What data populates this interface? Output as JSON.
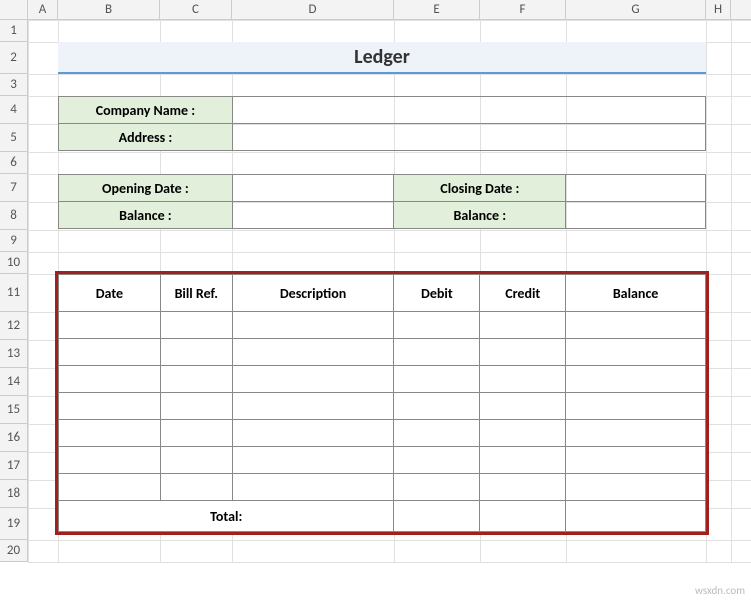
{
  "columns": [
    {
      "label": "A",
      "width": 30
    },
    {
      "label": "B",
      "width": 102
    },
    {
      "label": "C",
      "width": 72
    },
    {
      "label": "D",
      "width": 162
    },
    {
      "label": "E",
      "width": 86
    },
    {
      "label": "F",
      "width": 86
    },
    {
      "label": "G",
      "width": 140
    },
    {
      "label": "H",
      "width": 25
    }
  ],
  "rows": [
    {
      "label": "1",
      "height": 22
    },
    {
      "label": "2",
      "height": 32
    },
    {
      "label": "3",
      "height": 22
    },
    {
      "label": "4",
      "height": 28
    },
    {
      "label": "5",
      "height": 28
    },
    {
      "label": "6",
      "height": 22
    },
    {
      "label": "7",
      "height": 28
    },
    {
      "label": "8",
      "height": 28
    },
    {
      "label": "9",
      "height": 22
    },
    {
      "label": "10",
      "height": 22
    },
    {
      "label": "11",
      "height": 38
    },
    {
      "label": "12",
      "height": 28
    },
    {
      "label": "13",
      "height": 28
    },
    {
      "label": "14",
      "height": 28
    },
    {
      "label": "15",
      "height": 28
    },
    {
      "label": "16",
      "height": 28
    },
    {
      "label": "17",
      "height": 28
    },
    {
      "label": "18",
      "height": 28
    },
    {
      "label": "19",
      "height": 32
    },
    {
      "label": "20",
      "height": 22
    }
  ],
  "title": "Ledger",
  "info": {
    "company_label": "Company Name :",
    "company_value": "",
    "address_label": "Address :",
    "address_value": ""
  },
  "dates": {
    "opening_label": "Opening Date :",
    "opening_value": "",
    "open_balance_label": "Balance :",
    "open_balance_value": "",
    "closing_label": "Closing Date :",
    "closing_value": "",
    "close_balance_label": "Balance :",
    "close_balance_value": ""
  },
  "ledger": {
    "headers": [
      "Date",
      "Bill Ref.",
      "Description",
      "Debit",
      "Credit",
      "Balance"
    ],
    "rows": [
      [
        "",
        "",
        "",
        "",
        "",
        ""
      ],
      [
        "",
        "",
        "",
        "",
        "",
        ""
      ],
      [
        "",
        "",
        "",
        "",
        "",
        ""
      ],
      [
        "",
        "",
        "",
        "",
        "",
        ""
      ],
      [
        "",
        "",
        "",
        "",
        "",
        ""
      ],
      [
        "",
        "",
        "",
        "",
        "",
        ""
      ],
      [
        "",
        "",
        "",
        "",
        "",
        ""
      ]
    ],
    "total_label": "Total:",
    "total_debit": "",
    "total_credit": "",
    "total_balance": ""
  },
  "watermark": "wsxdn.com"
}
